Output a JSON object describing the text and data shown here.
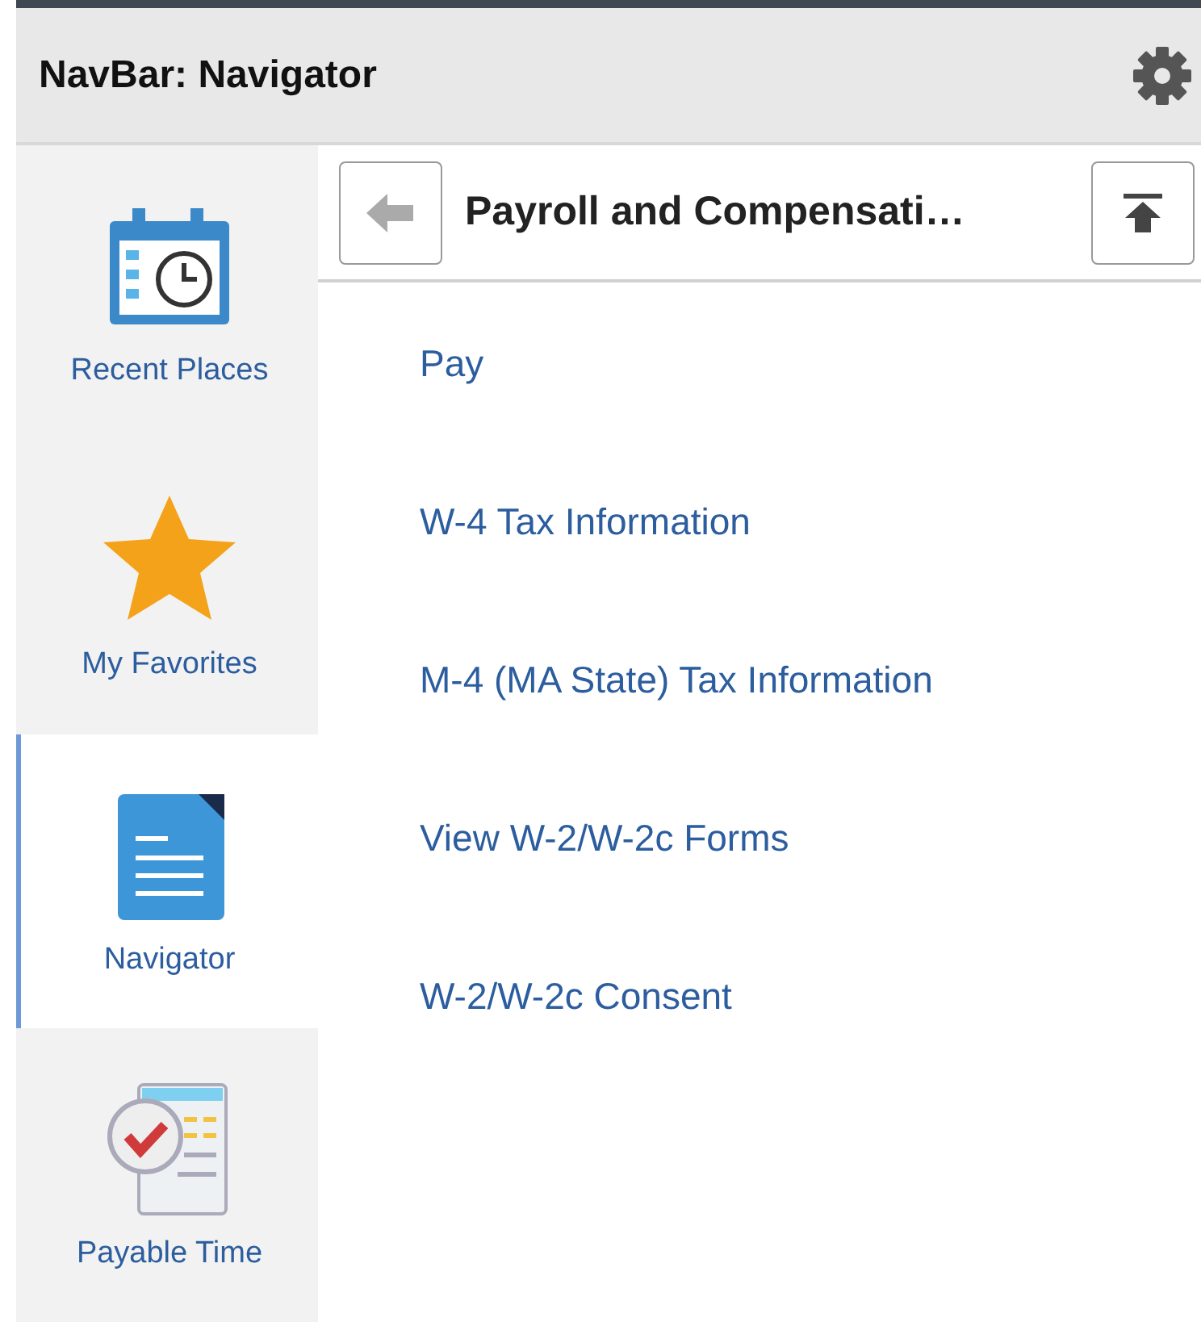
{
  "header": {
    "title": "NavBar: Navigator"
  },
  "sidebar": {
    "items": [
      {
        "label": "Recent Places",
        "kind": "calendar",
        "selected": false
      },
      {
        "label": "My Favorites",
        "kind": "star",
        "selected": false
      },
      {
        "label": "Navigator",
        "kind": "document",
        "selected": true
      },
      {
        "label": "Payable Time",
        "kind": "timesheet",
        "selected": false
      }
    ]
  },
  "panel": {
    "title": "Payroll and Compensati…",
    "links": [
      "Pay",
      "W-4 Tax Information",
      "M-4 (MA State) Tax Information",
      "View W-2/W-2c Forms",
      "W-2/W-2c Consent"
    ]
  }
}
